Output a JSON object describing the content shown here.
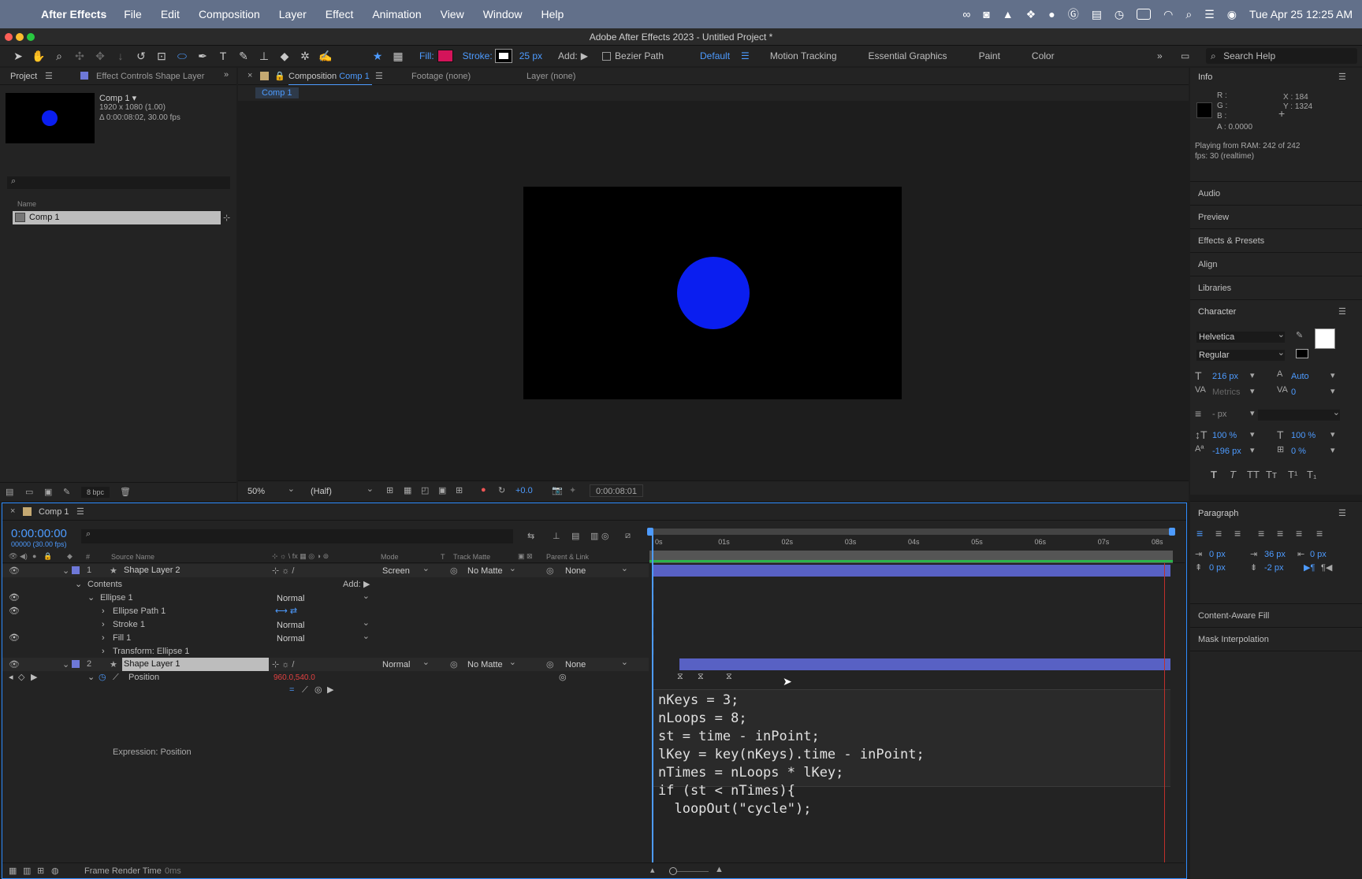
{
  "menubar": {
    "app": "After Effects",
    "items": [
      "File",
      "Edit",
      "Composition",
      "Layer",
      "Effect",
      "Animation",
      "View",
      "Window",
      "Help"
    ],
    "clock": "Tue Apr 25  12:25 AM"
  },
  "window_title": "Adobe After Effects 2023 - Untitled Project *",
  "toolbar": {
    "fill_label": "Fill:",
    "stroke_label": "Stroke:",
    "stroke_width": "25 px",
    "add_label": "Add:",
    "bezier_label": "Bezier Path",
    "workspaces": [
      "Default",
      "Motion Tracking",
      "Essential Graphics",
      "Paint",
      "Color"
    ],
    "search_placeholder": "Search Help",
    "fill_color": "#d4145a"
  },
  "project_panel": {
    "tab": "Project",
    "tab2": "Effect Controls Shape Layer",
    "comp_name": "Comp 1",
    "comp_info1": "1920 x 1080 (1.00)",
    "comp_info2": "Δ 0:00:08:02, 30.00 fps",
    "col_name": "Name",
    "item": "Comp 1",
    "bpc": "8 bpc"
  },
  "comp_panel": {
    "tab_prefix": "Composition",
    "tab_comp": "Comp 1",
    "footage": "Footage (none)",
    "layer": "Layer (none)",
    "crumb": "Comp 1",
    "zoom": "50%",
    "res": "(Half)",
    "exposure": "+0.0",
    "time": "0:00:08:01",
    "circle_color": "#0a1ef0"
  },
  "info_panel": {
    "title": "Info",
    "r": "R :",
    "g": "G :",
    "b": "B :",
    "a": "A :  0.0000",
    "x": "X : 184",
    "y": "Y : 1324",
    "status1": "Playing from RAM: 242 of 242",
    "status2": "fps: 30 (realtime)"
  },
  "right_items": [
    "Audio",
    "Preview",
    "Effects & Presets",
    "Align",
    "Libraries"
  ],
  "character": {
    "title": "Character",
    "font": "Helvetica",
    "style": "Regular",
    "size": "216 px",
    "leading": "Auto",
    "kerning": "Metrics",
    "tracking": "0",
    "stroke": "- px",
    "vscale": "100 %",
    "hscale": "100 %",
    "baseline": "-196 px",
    "tsume": "0 %",
    "styles": [
      "T",
      "T",
      "TT",
      "Tт",
      "T¹",
      "T₁"
    ]
  },
  "paragraph": {
    "title": "Paragraph",
    "indent_l": "0 px",
    "indent_first": "36 px",
    "indent_r": "0 px",
    "space_before": "0 px",
    "space_after": "-2 px"
  },
  "bottom_right": [
    "Content-Aware Fill",
    "Mask Interpolation"
  ],
  "timeline": {
    "tab": "Comp 1",
    "timecode": "0:00:00:00",
    "timecode_sub": "00000 (30.00 fps)",
    "col_hash": "#",
    "col_source": "Source Name",
    "col_mode": "Mode",
    "col_t": "T",
    "col_matte": "Track Matte",
    "col_parent": "Parent & Link",
    "ruler": [
      "0s",
      "01s",
      "02s",
      "03s",
      "04s",
      "05s",
      "06s",
      "07s",
      "08s"
    ],
    "layer1": {
      "num": "1",
      "name": "Shape Layer 2",
      "mode": "Screen",
      "matte": "No Matte",
      "parent": "None"
    },
    "contents": "Contents",
    "add_label": "Add:",
    "ellipse": "Ellipse 1",
    "ellipse_mode": "Normal",
    "ellipse_path": "Ellipse Path 1",
    "stroke": "Stroke 1",
    "stroke_mode": "Normal",
    "fill": "Fill 1",
    "fill_mode": "Normal",
    "transform": "Transform: Ellipse 1",
    "layer2": {
      "num": "2",
      "name": "Shape Layer 1",
      "mode": "Normal",
      "matte": "No Matte",
      "parent": "None"
    },
    "position_label": "Position",
    "position_value": "960.0,540.0",
    "expr_label": "Expression: Position",
    "code": [
      "nKeys = 3;",
      "nLoops = 8;",
      "st = time - inPoint;",
      "lKey = key(nKeys).time - inPoint;",
      "nTimes = nLoops * lKey;",
      "if (st < nTimes){",
      "  loopOut(\"cycle\");"
    ],
    "frame_render": "Frame Render Time",
    "frame_render_val": "0ms"
  }
}
